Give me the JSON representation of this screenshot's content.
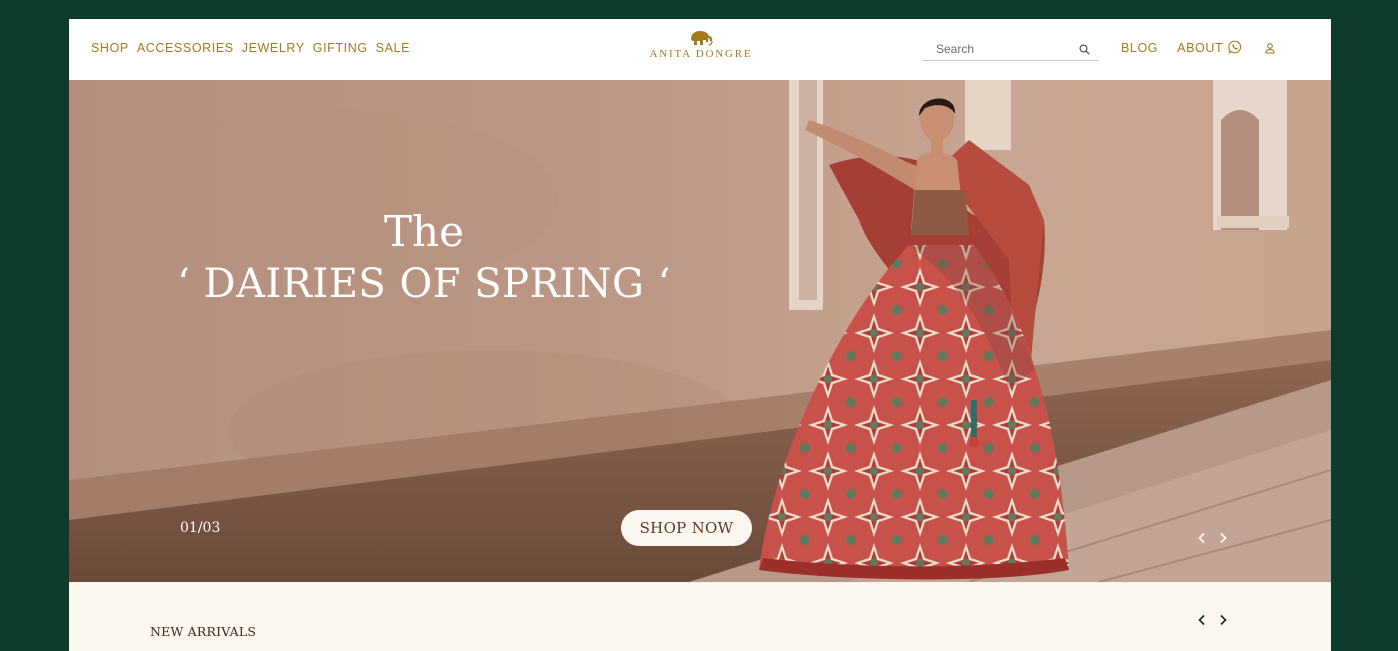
{
  "brand": {
    "name": "ANITA DONGRE",
    "logo_icon": "elephant-icon",
    "color": "#a37a1f"
  },
  "nav_left": [
    "SHOP",
    "ACCESSORIES",
    "JEWELRY",
    "GIFTING",
    "SALE"
  ],
  "search": {
    "placeholder": "Search",
    "icon": "search-icon"
  },
  "nav_right": [
    "BLOG",
    "ABOUT"
  ],
  "header_icons": [
    "whatsapp-icon",
    "user-icon"
  ],
  "hero": {
    "title_line1": "The",
    "title_line2": "‘ DAIRIES OF SPRING ‘",
    "counter": "01/03",
    "cta": "SHOP NOW",
    "arrows": [
      "chevron-left-icon",
      "chevron-right-icon"
    ]
  },
  "new_arrivals": {
    "title": "NEW ARRIVALS",
    "arrows": [
      "chevron-left-icon",
      "chevron-right-icon"
    ]
  },
  "colors": {
    "frame": "#0f3b2c",
    "page_bg": "#fbf7ef",
    "accent_gold": "#a37a1f"
  }
}
